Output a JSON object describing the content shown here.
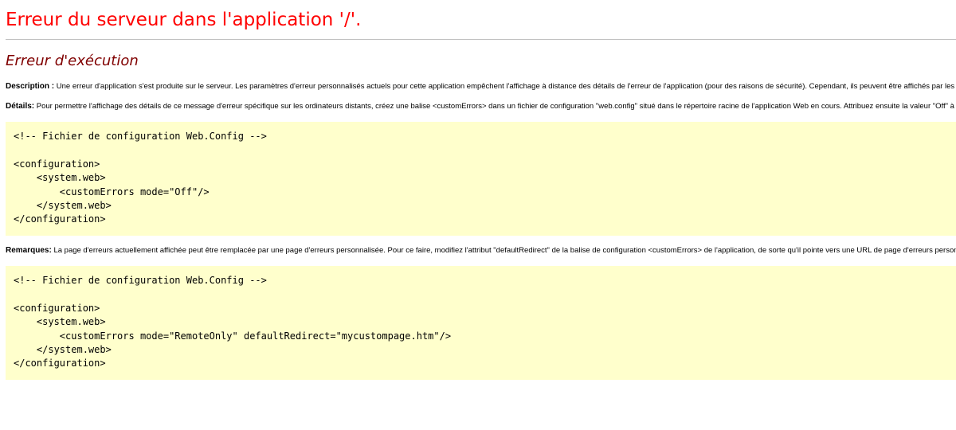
{
  "page": {
    "title": "Erreur du serveur dans l'application '/'.",
    "subtitle": "Erreur d'exécution"
  },
  "description": {
    "label": "Description :",
    "text": "Une erreur d'application s'est produite sur le serveur. Les paramètres d'erreur personnalisés actuels pour cette application empêchent l'affichage à distance des détails de l'erreur de l'application (pour des raisons de sécurité). Cependant, ils peuvent être affichés par les navigateurs exécutés sur l'ordinateur serveur local."
  },
  "details": {
    "label": "Détails:",
    "text": "Pour permettre l'affichage des détails de ce message d'erreur spécifique sur les ordinateurs distants, créez une balise <customErrors> dans un fichier de configuration \"web.config\" situé dans le répertoire racine de l'application Web en cours. Attribuez ensuite la valeur \"Off\" à l'attribut \"mode\" de cette balise <customErrors>."
  },
  "code_block_1": {
    "text": "<!-- Fichier de configuration Web.Config -->\n\n<configuration>\n    <system.web>\n        <customErrors mode=\"Off\"/>\n    </system.web>\n</configuration>"
  },
  "remarks": {
    "label": "Remarques:",
    "text": "La page d'erreurs actuellement affichée peut être remplacée par une page d'erreurs personnalisée. Pour ce faire, modifiez l'attribut \"defaultRedirect\" de la balise de configuration <customErrors> de l'application, de sorte qu'il pointe vers une URL de page d'erreurs personnalisée."
  },
  "code_block_2": {
    "text": "<!-- Fichier de configuration Web.Config -->\n\n<configuration>\n    <system.web>\n        <customErrors mode=\"RemoteOnly\" defaultRedirect=\"mycustompage.htm\"/>\n    </system.web>\n</configuration>"
  },
  "colors": {
    "title": "#ff0000",
    "subtitle": "#800000",
    "code_background": "#ffffcc"
  }
}
